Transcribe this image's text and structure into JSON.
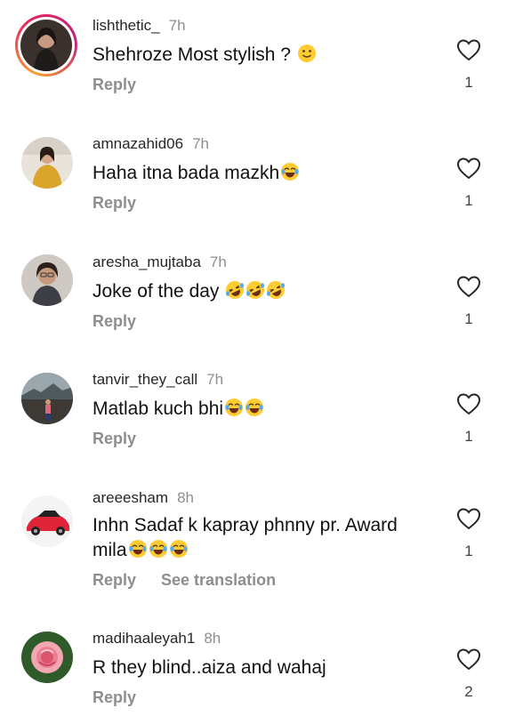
{
  "comments": [
    {
      "username": "lishthetic_",
      "time": "7h",
      "text": "Shehroze Most stylish ?",
      "emojis": [
        "slightly-smiling-face"
      ],
      "reply": "Reply",
      "likes": "1",
      "story_ring": true
    },
    {
      "username": "amnazahid06",
      "time": "7h",
      "text": "Haha itna bada mazkh",
      "emojis": [
        "face-with-tears-of-joy"
      ],
      "reply": "Reply",
      "likes": "1"
    },
    {
      "username": "aresha_mujtaba",
      "time": "7h",
      "text": "Joke of the day",
      "emojis": [
        "rolling-on-floor-laughing",
        "rolling-on-floor-laughing",
        "rolling-on-floor-laughing"
      ],
      "reply": "Reply",
      "likes": "1"
    },
    {
      "username": "tanvir_they_call",
      "time": "7h",
      "text": "Matlab kuch bhi",
      "emojis": [
        "face-with-tears-of-joy",
        "face-with-tears-of-joy"
      ],
      "reply": "Reply",
      "likes": "1"
    },
    {
      "username": "areeesham",
      "time": "8h",
      "text_line1": "Inhn Sadaf k kapray phnny pr. Award",
      "text_line2": "mila",
      "emojis": [
        "face-with-tears-of-joy",
        "face-with-tears-of-joy",
        "face-with-tears-of-joy"
      ],
      "reply": "Reply",
      "translate": "See translation",
      "likes": "1"
    },
    {
      "username": "madihaaleyah1",
      "time": "8h",
      "text": "R they blind..aiza and wahaj",
      "emojis": [],
      "reply": "Reply",
      "likes": "2"
    }
  ],
  "icons": {
    "like": "heart-outline-icon"
  },
  "colors": {
    "secondary_text": "#8e8e8e",
    "story_ring_start": "#f9a033",
    "story_ring_end": "#c0227a"
  }
}
